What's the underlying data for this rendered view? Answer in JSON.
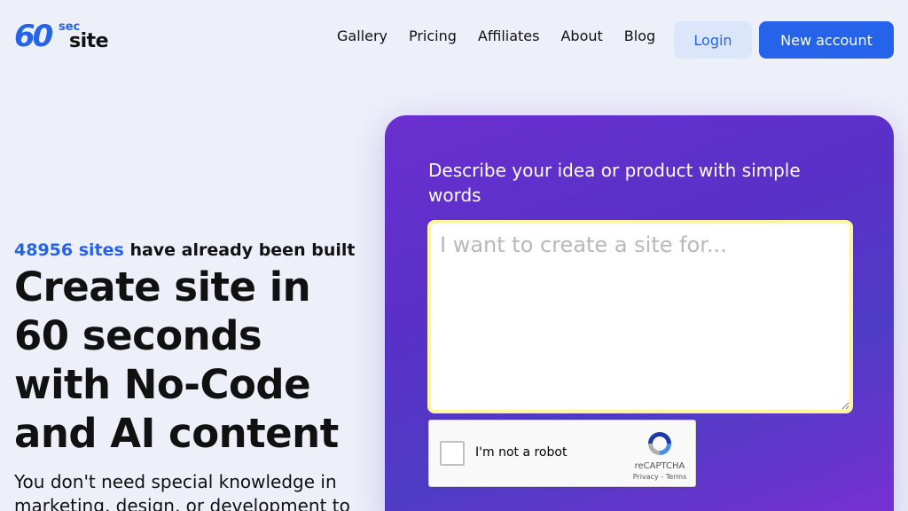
{
  "brand": {
    "logo_number": "60",
    "logo_sec": "sec",
    "logo_site": "site"
  },
  "nav": {
    "items": [
      {
        "label": "Gallery"
      },
      {
        "label": "Pricing"
      },
      {
        "label": "Affiliates"
      },
      {
        "label": "About"
      },
      {
        "label": "Blog"
      }
    ]
  },
  "header": {
    "login_label": "Login",
    "new_account_label": "New account"
  },
  "hero": {
    "count": "48956 sites",
    "count_suffix": "have already been built",
    "title": "Create site in 60 seconds with No-Code and AI content",
    "subtitle": "You don't need special knowledge in marketing, design, or development to"
  },
  "form": {
    "label": "Describe your idea or product with simple words",
    "input_placeholder": "I want to create a site for...",
    "input_value": ""
  },
  "recaptcha": {
    "label": "I'm not a robot",
    "brand": "reCAPTCHA",
    "links": "Privacy - Terms"
  },
  "colors": {
    "accent": "#2563eb",
    "background": "#eef0f9",
    "card_gradient_start": "#6a2fd0",
    "card_gradient_end": "#7a2fd4",
    "input_focus_border": "#fff59a"
  }
}
